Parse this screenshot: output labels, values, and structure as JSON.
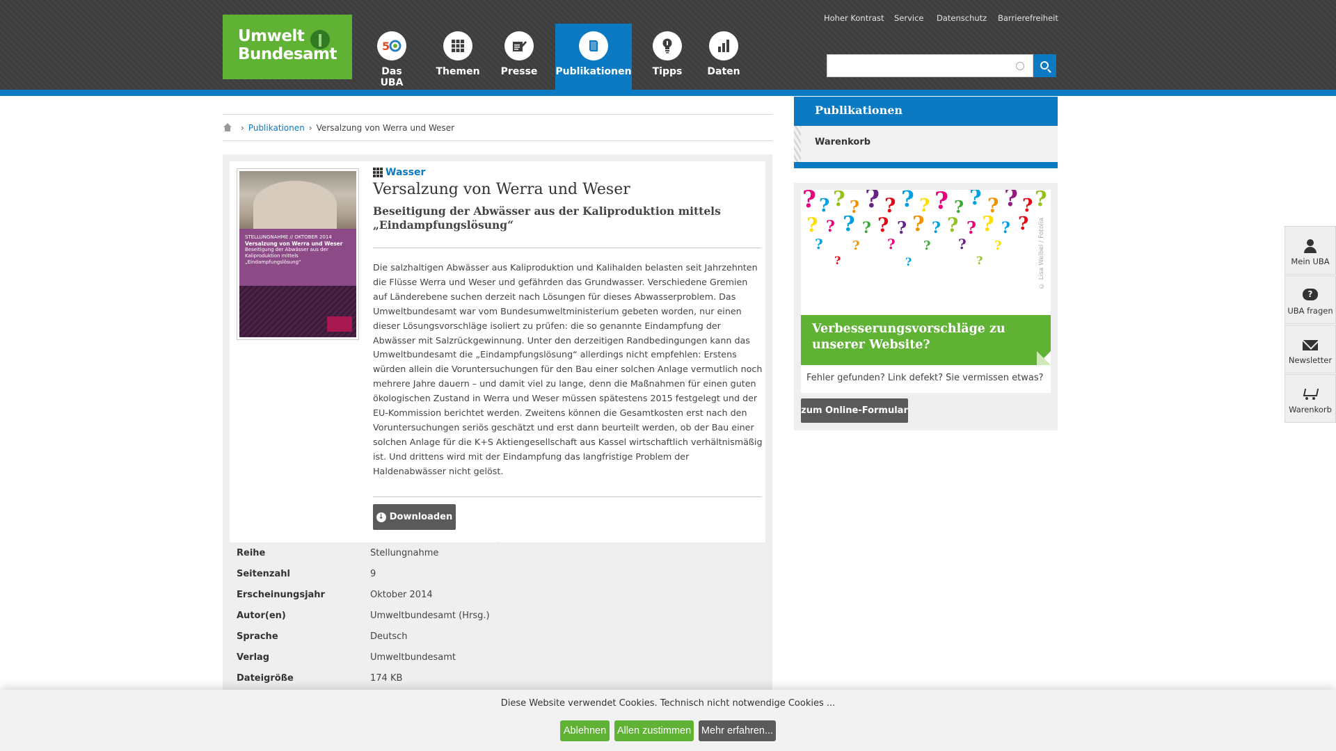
{
  "header": {
    "logo_line1": "Umwelt",
    "logo_line2": "Bundesamt",
    "nav": [
      {
        "label": "Das UBA",
        "icon": "uba-50-icon"
      },
      {
        "label": "Themen",
        "icon": "grid-icon"
      },
      {
        "label": "Presse",
        "icon": "pen-paper-icon"
      },
      {
        "label": "Publikationen",
        "icon": "book-icon",
        "active": true
      },
      {
        "label": "Tipps",
        "icon": "lightbulb-icon"
      },
      {
        "label": "Daten",
        "icon": "bar-chart-icon"
      }
    ],
    "meta_links": [
      "Hoher Kontrast",
      "Service",
      "Datenschutz",
      "Barrierefreiheit"
    ],
    "search": {
      "value": "",
      "placeholder": ""
    }
  },
  "breadcrumb": {
    "home_icon": "home-icon",
    "items": [
      "Publikationen",
      "Versalzung von Werra und Weser"
    ]
  },
  "publication": {
    "cover": {
      "series_line": "STELLUNGNAHME // OKTOBER 2014",
      "title": "Versalzung von Werra und Weser",
      "subtitle": "Beseitigung der Abwässer aus der Kaliproduktion mittels „Eindampfungslösung“"
    },
    "topic": "Wasser",
    "title": "Versalzung von Werra und Weser",
    "subtitle": "Beseitigung der Abwässer aus der Kaliproduktion mittels „Eindampfungslösung“",
    "description": "Die salzhaltigen Abwässer aus Kaliproduktion und Kalihalden belasten seit Jahrzehnten die Flüsse Werra und Weser und gefährden das Grundwasser. Verschiedene Gremien auf Länderebene suchen derzeit nach Lösungen für dieses Abwasserproblem. Das Umweltbundesamt war vom Bundesumweltministerium gebeten worden, nur einen dieser Lösungsvorschläge isoliert zu prüfen: die so genannte Eindampfung der Abwässer mit Salzrückgewinnung. Unter den derzeitigen Randbedingungen kann das Umweltbundesamt die „Eindampfungslösung“ allerdings nicht empfehlen: Erstens würden allein die Voruntersuchungen für den Bau einer solchen Anlage vermutlich noch mehrere Jahre dauern – und damit viel zu lange, denn die Maßnahmen für einen guten ökologischen Zustand in Werra und Weser müssen spätestens 2015 festgelegt und der EU-Kommission berichtet werden. Zweitens können die Gesamtkosten erst nach den Voruntersuchungen seriös geschätzt und erst dann beurteilt werden, ob der Bau einer solchen Anlage für die K+S Aktiengesellschaft aus Kassel wirtschaftlich verhältnismäßig ist. Und drittens wird mit der Eindampfung das langfristige Problem der Haldenabwässer nicht gelöst.",
    "download_label": "Downloaden",
    "meta": [
      {
        "key": "Reihe",
        "value": "Stellungnahme"
      },
      {
        "key": "Seitenzahl",
        "value": "9"
      },
      {
        "key": "Erscheinungsjahr",
        "value": "Oktober 2014"
      },
      {
        "key": "Autor(en)",
        "value": "Umweltbundesamt (Hrsg.)"
      },
      {
        "key": "Sprache",
        "value": "Deutsch"
      },
      {
        "key": "Verlag",
        "value": "Umweltbundesamt"
      },
      {
        "key": "Dateigröße",
        "value": "174 KB"
      }
    ]
  },
  "sidebar": {
    "section_title": "Publikationen",
    "items": [
      "Warenkorb"
    ],
    "feedback": {
      "image_credit": "© Lisa Weibel / Fotolia",
      "heading": "Verbesserungsvorschläge zu unserer Website?",
      "text": "Fehler gefunden? Link defekt? Sie vermissen etwas?",
      "button": "zum Online-Formular"
    }
  },
  "service_bar": [
    {
      "label": "Mein UBA",
      "icon": "person-icon"
    },
    {
      "label": "UBA fragen",
      "icon": "question-bubble-icon"
    },
    {
      "label": "Newsletter",
      "icon": "mail-icon"
    },
    {
      "label": "Warenkorb",
      "icon": "cart-icon"
    }
  ],
  "cookie_banner": {
    "text": "Diese Website verwendet Cookies. Technisch nicht notwendige Cookies ...",
    "buttons": [
      "Ablehnen",
      "Allen zustimmen",
      "Mehr erfahren..."
    ]
  },
  "colors": {
    "brand_green": "#5fb233",
    "brand_blue": "#0b7ac2",
    "header_dark": "#3e3e3e",
    "button_gray": "#5a5a5a"
  }
}
